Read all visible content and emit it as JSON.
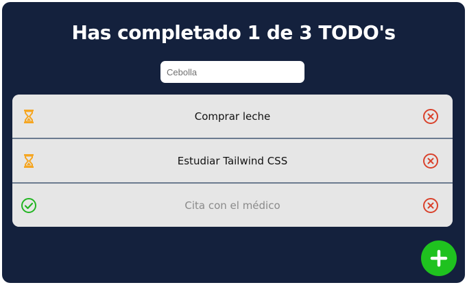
{
  "header": {
    "title": "Has completado 1 de 3 TODO's"
  },
  "search": {
    "placeholder": "Cebolla",
    "value": ""
  },
  "todos": [
    {
      "text": "Comprar leche",
      "status": "pending",
      "status_icon": "hourglass-icon"
    },
    {
      "text": "Estudiar Tailwind CSS",
      "status": "pending",
      "status_icon": "hourglass-icon"
    },
    {
      "text": "Cita con el médico",
      "status": "completed",
      "status_icon": "check-circle-icon"
    }
  ],
  "colors": {
    "background": "#14213d",
    "pending": "#f5a623",
    "completed": "#22b522",
    "delete": "#d9412b",
    "add_button": "#1fc21f"
  },
  "actions": {
    "delete_icon": "x-circle-icon",
    "add_icon": "plus-icon"
  }
}
